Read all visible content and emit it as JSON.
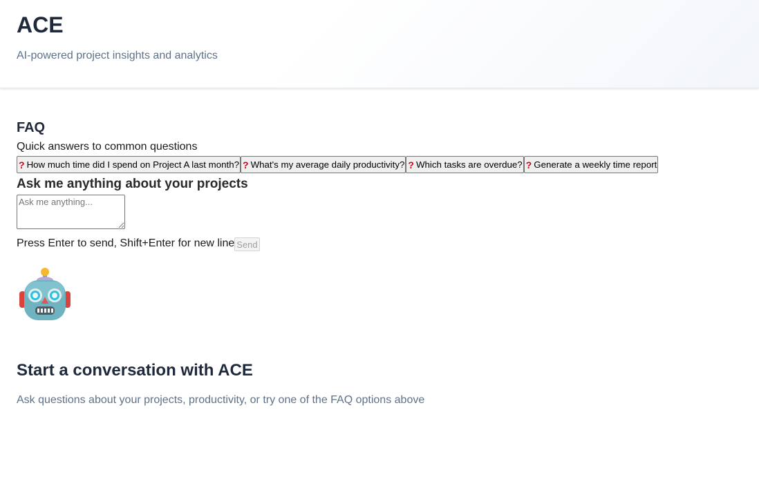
{
  "header": {
    "title": "ACE",
    "subtitle": "AI-powered project insights and analytics"
  },
  "faq": {
    "title": "FAQ",
    "subtitle": "Quick answers to common questions",
    "icon": "question-mark-icon",
    "items": [
      {
        "label": "How much time did I spend on Project A last month?"
      },
      {
        "label": "What's my average daily productivity?"
      },
      {
        "label": "Which tasks are overdue?"
      },
      {
        "label": "Generate a weekly time report"
      }
    ]
  },
  "chat": {
    "title": "Ask me anything about your projects",
    "placeholder": "Ask me anything...",
    "value": "",
    "hint": "Press Enter to send, Shift+Enter for new line",
    "send_label": "Send"
  },
  "empty_state": {
    "icon": "robot-icon",
    "title": "Start a conversation with ACE",
    "subtitle": "Ask questions about your projects, productivity, or try one of the FAQ options above"
  },
  "colors": {
    "title_text": "#1e293b",
    "muted_text": "#5f7188",
    "question_mark": "#d0021b"
  }
}
